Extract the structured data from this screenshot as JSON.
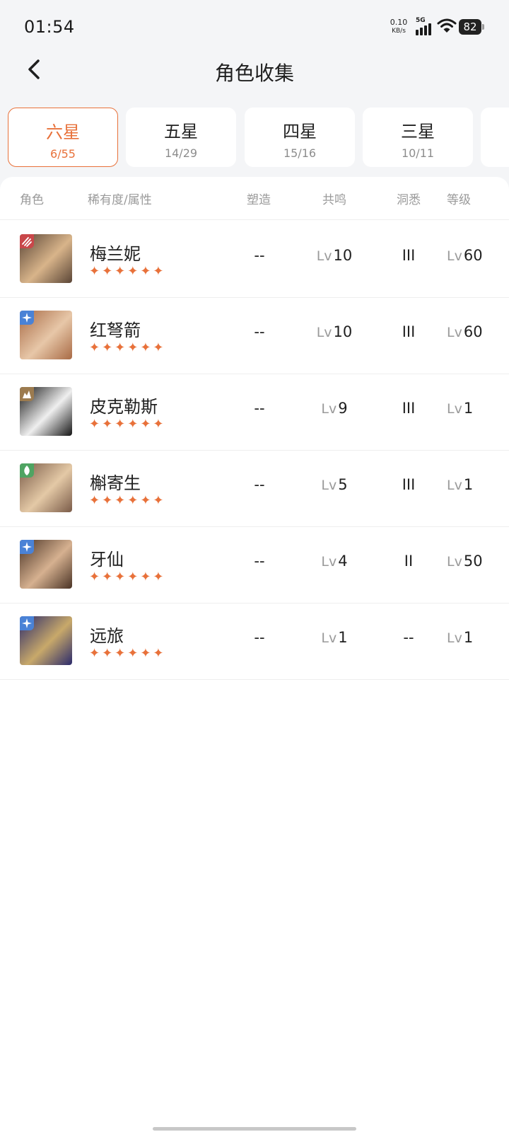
{
  "status": {
    "time": "01:54",
    "net_speed": "0.10",
    "net_unit": "KB/s",
    "network": "5G",
    "battery": "82"
  },
  "header": {
    "title": "角色收集"
  },
  "tabs": [
    {
      "name": "六星",
      "count": "6/55"
    },
    {
      "name": "五星",
      "count": "14/29"
    },
    {
      "name": "四星",
      "count": "15/16"
    },
    {
      "name": "三星",
      "count": "10/11"
    }
  ],
  "table": {
    "headers": {
      "character": "角色",
      "rarity": "稀有度/属性",
      "shape": "塑造",
      "resonance": "共鸣",
      "insight": "洞悉",
      "level": "等级"
    },
    "lv_prefix": "Lv",
    "stars": "✦✦✦✦✦✦",
    "rows": [
      {
        "name": "梅兰妮",
        "shape": "--",
        "resonance": "10",
        "insight": "III",
        "level": "60",
        "element_icon": "claw-icon",
        "element_color": "#c9474a",
        "avatar_colors": [
          "#5a4536",
          "#d8b48a"
        ]
      },
      {
        "name": "红弩箭",
        "shape": "--",
        "resonance": "10",
        "insight": "III",
        "level": "60",
        "element_icon": "star-spark-icon",
        "element_color": "#4a82d6",
        "avatar_colors": [
          "#a86a45",
          "#e7c7a8"
        ]
      },
      {
        "name": "皮克勒斯",
        "shape": "--",
        "resonance": "9",
        "insight": "III",
        "level": "1",
        "element_icon": "rock-icon",
        "element_color": "#9c7b4f",
        "avatar_colors": [
          "#151515",
          "#efefef"
        ]
      },
      {
        "name": "槲寄生",
        "shape": "--",
        "resonance": "5",
        "insight": "III",
        "level": "1",
        "element_icon": "leaf-icon",
        "element_color": "#4fa462",
        "avatar_colors": [
          "#7a5b48",
          "#e4c9a6"
        ]
      },
      {
        "name": "牙仙",
        "shape": "--",
        "resonance": "4",
        "insight": "II",
        "level": "50",
        "element_icon": "star-spark-icon",
        "element_color": "#4a82d6",
        "avatar_colors": [
          "#4a3325",
          "#d6b190"
        ]
      },
      {
        "name": "远旅",
        "shape": "--",
        "resonance": "1",
        "insight": "--",
        "level": "1",
        "element_icon": "star-spark-icon",
        "element_color": "#4a82d6",
        "avatar_colors": [
          "#2b2a6b",
          "#c8a96a"
        ]
      }
    ]
  }
}
